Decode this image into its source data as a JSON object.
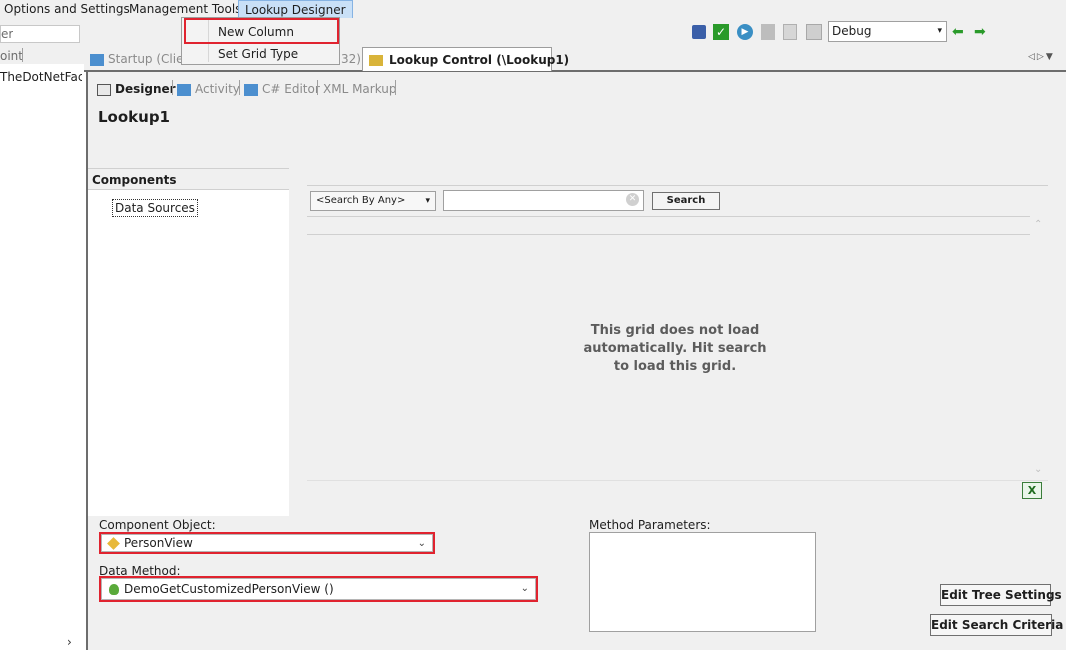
{
  "menubar": {
    "items": [
      "Options and Settings",
      "Management Tools",
      "Lookup Designer"
    ]
  },
  "dropdown": {
    "items": [
      "New Column",
      "Set Grid Type"
    ]
  },
  "left_strip": {
    "line1": "er",
    "line2": "oint",
    "line3": "TheDotNetFactc"
  },
  "toolbar": {
    "config_select": "Debug"
  },
  "doc_tabs": {
    "startup": "Startup (Clien",
    "startup_suffix": "32)",
    "lookup": "Lookup Control (\\Lookup1)"
  },
  "sub_tabs": [
    "Designer",
    "Activity",
    "C# Editor",
    "XML Markup"
  ],
  "designer": {
    "title": "Lookup1",
    "components_header": "Components",
    "data_sources": "Data Sources"
  },
  "grid": {
    "search_by": "<Search By Any>",
    "search_value": "",
    "search_button": "Search",
    "message": "This grid does not load automatically. Hit search to load this grid."
  },
  "form": {
    "component_object_label": "Component Object:",
    "component_object_value": "PersonView",
    "data_method_label": "Data Method:",
    "data_method_value": "DemoGetCustomizedPersonView ()",
    "method_params_label": "Method Parameters:",
    "edit_tree_button": "Edit Tree Settings",
    "edit_search_button": "Edit Search Criteria"
  },
  "colors": {
    "highlight_red": "#e0232f",
    "menu_active": "#c9e0f7"
  }
}
